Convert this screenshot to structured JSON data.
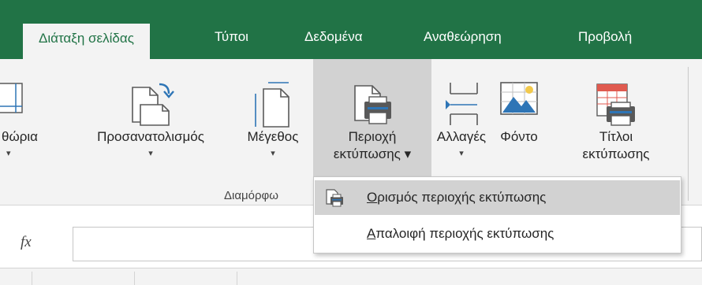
{
  "tabs": [
    {
      "label": "Διάταξη σελίδας",
      "active": true
    },
    {
      "label": "Τύποι"
    },
    {
      "label": "Δεδομένα"
    },
    {
      "label": "Αναθεώρηση"
    },
    {
      "label": "Προβολή"
    }
  ],
  "ribbon": {
    "buttons": [
      {
        "line1": "θώρια",
        "caret": "▾"
      },
      {
        "line1": "Προσανατολισμός",
        "caret": "▾"
      },
      {
        "line1": "Μέγεθος",
        "caret": "▾"
      },
      {
        "line1": "Περιοχή",
        "line2": "εκτύπωσης ▾"
      },
      {
        "line1": "Αλλαγές",
        "caret": "▾"
      },
      {
        "line1": "Φόντο"
      },
      {
        "line1": "Τίτλοι",
        "line2": "εκτύπωσης"
      }
    ],
    "group_label": "Διαμόρφω"
  },
  "formula_bar": {
    "fx_label": "fx",
    "value": ""
  },
  "dropdown": {
    "items": [
      {
        "accel": "Ο",
        "rest": "ρισμός περιοχής εκτύπωσης"
      },
      {
        "accel": "Α",
        "rest": "παλοιφή περιοχής εκτύπωσης"
      }
    ]
  },
  "colors": {
    "accent": "#217346",
    "ribbon": "#f3f3f3",
    "highlight": "#d2d2d2"
  }
}
